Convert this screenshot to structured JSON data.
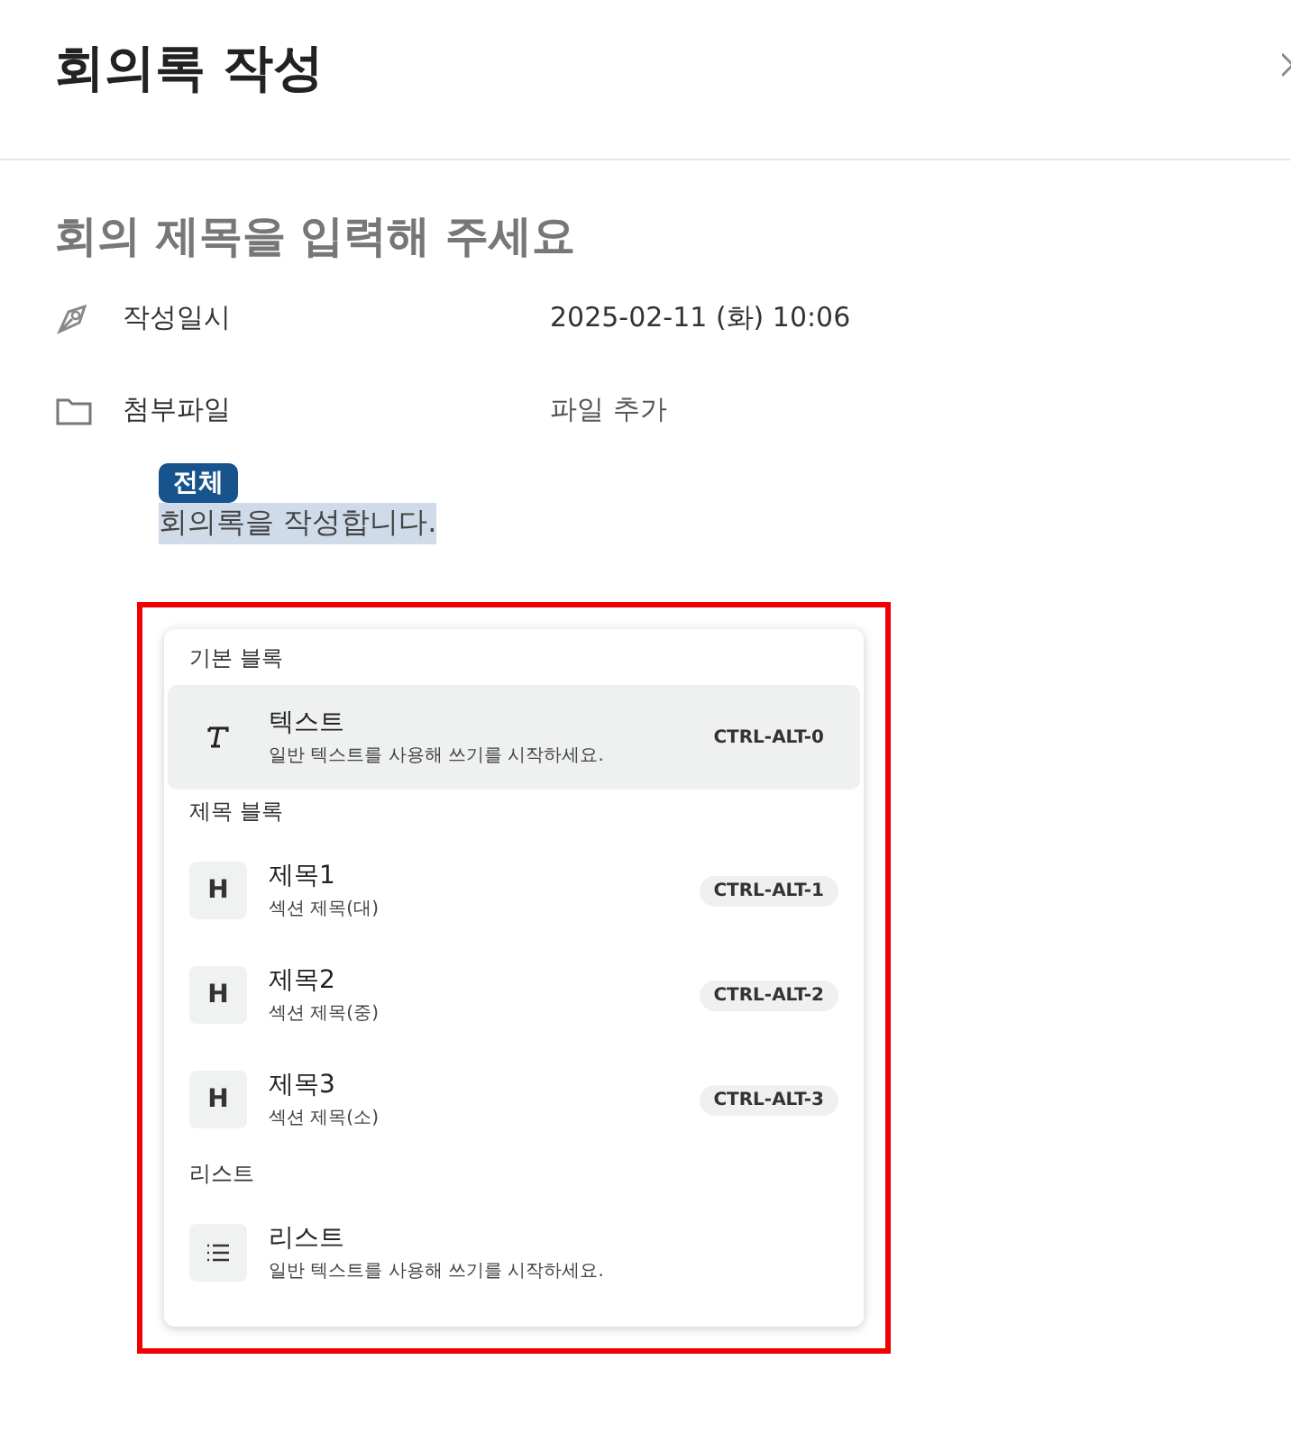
{
  "header": {
    "title": "회의록 작성"
  },
  "title_field": {
    "placeholder": "회의 제목을 입력해 주세요"
  },
  "fields": [
    {
      "kind": "pen",
      "label": "작성일시",
      "value": "2025-02-11 (화) 10:06"
    },
    {
      "kind": "folder",
      "label": "첨부파일",
      "value": "파일 추가"
    }
  ],
  "content": {
    "tag": "전체",
    "text": "회의록을 작성합니다.",
    "text_selected": true
  },
  "block_menu": {
    "highlighted": true,
    "groups": [
      {
        "label": "기본 블록",
        "items": [
          {
            "kind": "text",
            "title": "텍스트",
            "description": "일반 텍스트를 사용해 쓰기를 시작하세요.",
            "shortcut": "CTRL-ALT-0",
            "selected": true
          }
        ]
      },
      {
        "label": "제목 블록",
        "items": [
          {
            "kind": "heading",
            "icon": "H",
            "title": "제목1",
            "description": "섹션 제목(대)",
            "shortcut": "CTRL-ALT-1",
            "selected": false
          },
          {
            "kind": "heading",
            "icon": "H",
            "title": "제목2",
            "description": "섹션 제목(중)",
            "shortcut": "CTRL-ALT-2",
            "selected": false
          },
          {
            "kind": "heading",
            "icon": "H",
            "title": "제목3",
            "description": "섹션 제목(소)",
            "shortcut": "CTRL-ALT-3",
            "selected": false
          }
        ]
      },
      {
        "label": "리스트",
        "items": [
          {
            "kind": "list",
            "title": "리스트",
            "description": "일반 텍스트를 사용해 쓰기를 시작하세요.",
            "selected": false
          }
        ]
      }
    ]
  }
}
